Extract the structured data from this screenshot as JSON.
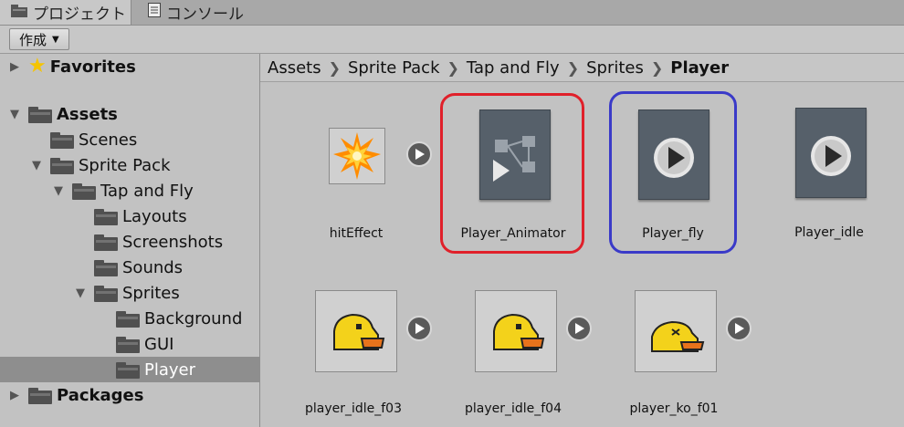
{
  "tabs": [
    {
      "label": "プロジェクト",
      "icon": "folder-icon"
    },
    {
      "label": "コンソール",
      "icon": "console-icon"
    }
  ],
  "toolbar": {
    "create_label": "作成"
  },
  "tree": {
    "favorites": "Favorites",
    "assets": "Assets",
    "scenes": "Scenes",
    "sprite_pack": "Sprite Pack",
    "tap_and_fly": "Tap and Fly",
    "layouts": "Layouts",
    "screenshots": "Screenshots",
    "sounds": "Sounds",
    "sprites": "Sprites",
    "background": "Background",
    "gui": "GUI",
    "player": "Player",
    "packages": "Packages"
  },
  "breadcrumb": [
    "Assets",
    "Sprite Pack",
    "Tap and Fly",
    "Sprites",
    "Player"
  ],
  "assets": {
    "hit_effect": "hitEffect",
    "player_animator": "Player_Animator",
    "player_fly": "Player_fly",
    "player_idle": "Player_idle",
    "player_idle_f03": "player_idle_f03",
    "player_idle_f04": "player_idle_f04",
    "player_ko_f01": "player_ko_f01"
  },
  "highlights": {
    "red": "#e0202a",
    "blue": "#3a3ac8"
  }
}
